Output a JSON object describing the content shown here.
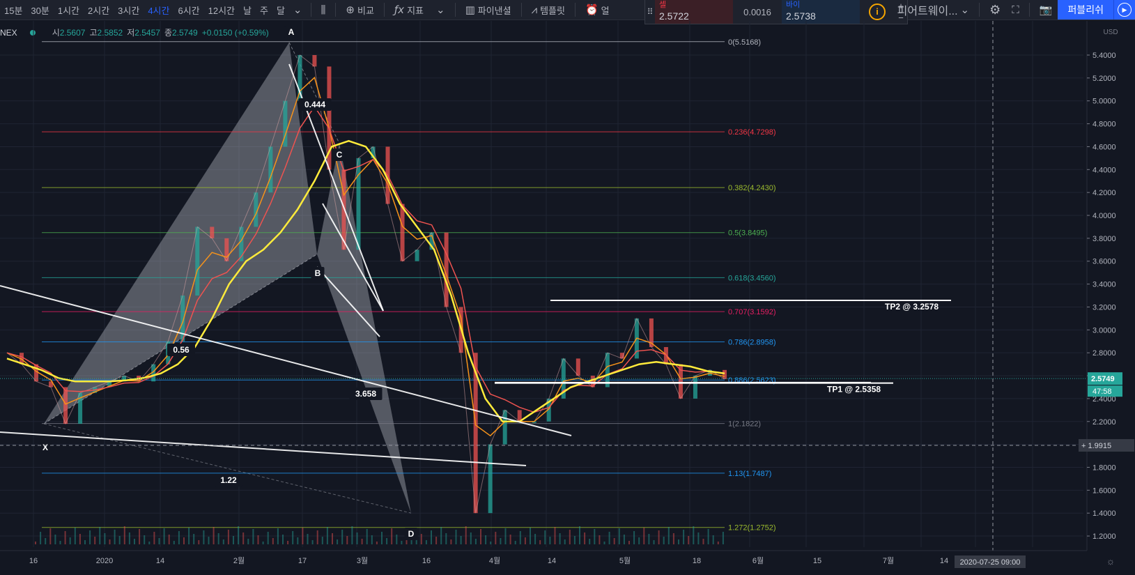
{
  "toolbar": {
    "timeframes": [
      "15분",
      "30분",
      "1시간",
      "2시간",
      "3시간",
      "4시간",
      "6시간",
      "12시간",
      "날",
      "주",
      "달"
    ],
    "active_timeframe": "4시간",
    "compare_label": "비교",
    "indicators_label": "지표",
    "pinescript_label": "파이낸셜",
    "templates_label": "템플릿",
    "alert_label": "얼",
    "layout_label": "피어트웨이...",
    "publish_label": "퍼블리쉬"
  },
  "trade_panel": {
    "sell_label": "셀",
    "sell_price": "2.5722",
    "spread": "0.0016",
    "buy_label": "바이",
    "buy_price": "2.5738"
  },
  "legend": {
    "symbol": "NEX",
    "open_label": "시",
    "open": "2.5607",
    "high_label": "고",
    "high": "2.5852",
    "low_label": "저",
    "low": "2.5457",
    "close_label": "종",
    "close": "2.5749",
    "change": "+0.0150 (+0.59%)"
  },
  "price_axis": {
    "currency": "USD",
    "ticks": [
      "5.4000",
      "5.2000",
      "5.0000",
      "4.8000",
      "4.6000",
      "4.4000",
      "4.2000",
      "4.0000",
      "3.8000",
      "3.6000",
      "3.4000",
      "3.2000",
      "3.0000",
      "2.8000",
      "2.6000",
      "2.4000",
      "2.2000",
      "2.0000",
      "1.8000",
      "1.6000",
      "1.4000",
      "1.2000"
    ],
    "last_price": "2.5749",
    "countdown": "47:58",
    "crosshair_price": "1.9915"
  },
  "time_axis": {
    "ticks": [
      "16",
      "2020",
      "14",
      "2월",
      "17",
      "3월",
      "16",
      "4월",
      "14",
      "5월",
      "18",
      "6월",
      "15",
      "7월",
      "14"
    ],
    "crosshair_time": "2020-07-25  09:00"
  },
  "colors": {
    "background": "#131722",
    "ema_fast": "#f7931a",
    "ema_mid": "#ef5350",
    "ema_slow": "#ffeb3b",
    "pattern_fill": "#d1d4dc",
    "up_candle": "#26a69a",
    "down_candle": "#ef5350"
  },
  "chart_data": {
    "type": "line",
    "symbol": "NEX",
    "yrange": [
      1.2,
      5.6
    ],
    "fib_levels": [
      {
        "label": "0(5.5168)",
        "value": 5.5168,
        "color": "#b2b5be"
      },
      {
        "label": "0.236(4.7298)",
        "value": 4.7298,
        "color": "#f23645"
      },
      {
        "label": "0.382(4.2430)",
        "value": 4.243,
        "color": "#9bbb2e"
      },
      {
        "label": "0.5(3.8495)",
        "value": 3.8495,
        "color": "#4caf50"
      },
      {
        "label": "0.618(3.4560)",
        "value": 3.456,
        "color": "#26a69a"
      },
      {
        "label": "0.707(3.1592)",
        "value": 3.1592,
        "color": "#e91e63"
      },
      {
        "label": "0.786(2.8958)",
        "value": 2.8958,
        "color": "#2196f3"
      },
      {
        "label": "0.886(2.5623)",
        "value": 2.5623,
        "color": "#2196f3"
      },
      {
        "label": "1(2.1822)",
        "value": 2.1822,
        "color": "#787b86"
      },
      {
        "label": "1.13(1.7487)",
        "value": 1.7487,
        "color": "#2196f3"
      },
      {
        "label": "1.272(1.2752)",
        "value": 1.2752,
        "color": "#9bbb2e"
      }
    ],
    "pattern_points": [
      {
        "name": "X",
        "value": 2.18
      },
      {
        "name": "A",
        "value": 5.51
      },
      {
        "name": "B",
        "value": 3.66
      },
      {
        "name": "C",
        "value": 4.63
      },
      {
        "name": "D",
        "value": 1.4
      }
    ],
    "pattern_ratios": [
      "0.56",
      "0.444",
      "3.658",
      "1.22"
    ],
    "targets": [
      {
        "label": "TP2 @ 3.2578",
        "value": 3.2578
      },
      {
        "label": "TP1 @ 2.5358",
        "value": 2.5358
      }
    ],
    "price_series": [
      2.8,
      2.7,
      2.55,
      2.5,
      2.18,
      2.45,
      2.5,
      2.55,
      2.6,
      2.55,
      2.7,
      2.9,
      3.3,
      3.9,
      3.8,
      3.6,
      3.9,
      4.2,
      4.6,
      5.0,
      5.4,
      5.3,
      4.4,
      3.7,
      4.5,
      4.6,
      4.1,
      3.6,
      3.7,
      3.85,
      3.2,
      2.8,
      1.4,
      2.0,
      2.3,
      2.2,
      2.2,
      2.4,
      2.75,
      2.6,
      2.5,
      2.8,
      2.75,
      3.1,
      2.85,
      2.7,
      2.4,
      2.6,
      2.65,
      2.57
    ],
    "ema_slow_series": [
      2.75,
      2.7,
      2.65,
      2.58,
      2.55,
      2.55,
      2.55,
      2.56,
      2.58,
      2.62,
      2.7,
      2.85,
      3.1,
      3.4,
      3.6,
      3.7,
      3.85,
      4.05,
      4.3,
      4.6,
      4.65,
      4.6,
      4.4,
      4.1,
      3.9,
      3.7,
      3.3,
      2.8,
      2.4,
      2.2,
      2.2,
      2.3,
      2.4,
      2.5,
      2.55,
      2.6,
      2.65,
      2.7,
      2.72,
      2.7,
      2.68,
      2.64,
      2.62
    ]
  }
}
